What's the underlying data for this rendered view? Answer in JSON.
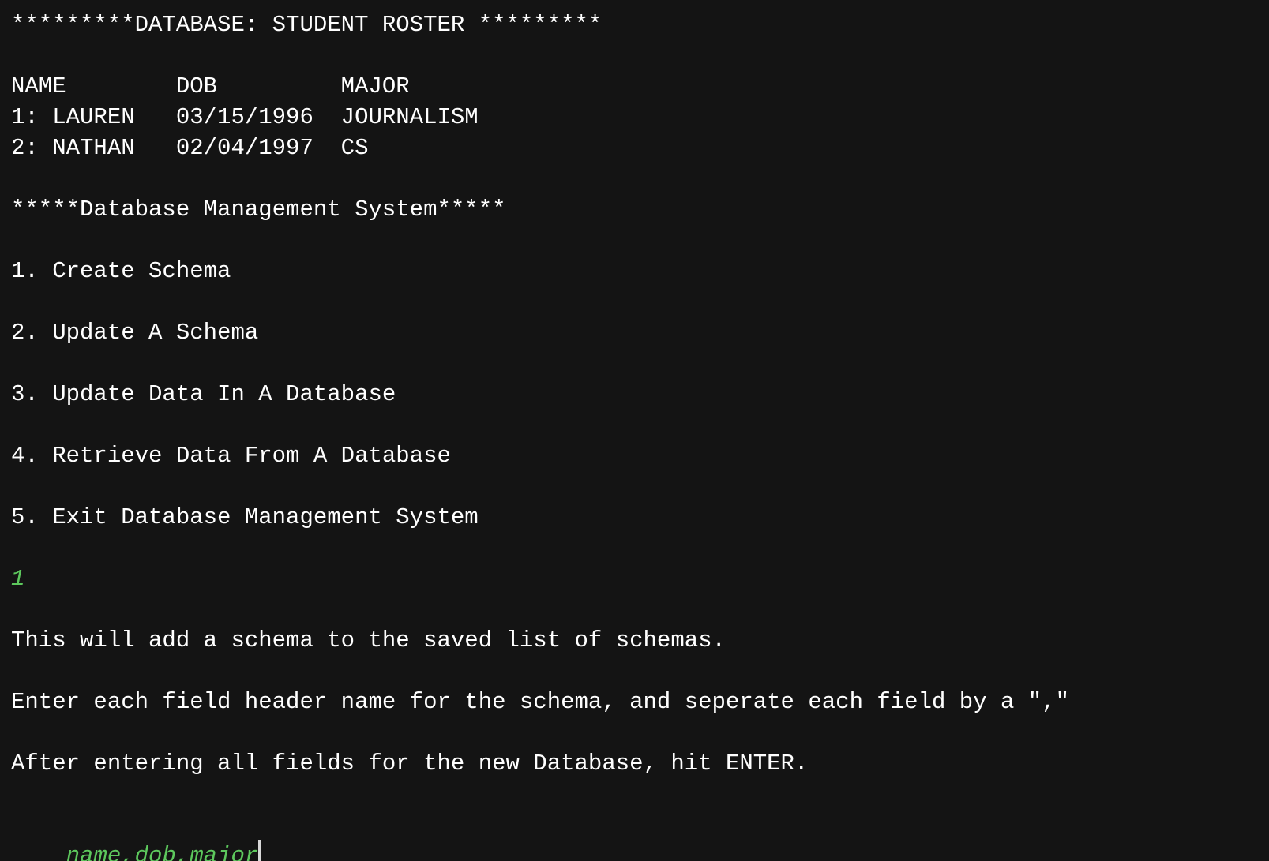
{
  "terminal": {
    "banner": "*********DATABASE: STUDENT ROSTER *********",
    "roster": {
      "header": "NAME        DOB         MAJOR",
      "rows": [
        "1: LAUREN   03/15/1996  JOURNALISM",
        "2: NATHAN   02/04/1997  CS"
      ]
    },
    "menu_title": "*****Database Management System*****",
    "menu": [
      "1. Create Schema",
      "2. Update A Schema",
      "3. Update Data In A Database",
      "4. Retrieve Data From A Database",
      "5. Exit Database Management System"
    ],
    "user_choice": "1",
    "messages": [
      "This will add a schema to the saved list of schemas.",
      "Enter each field header name for the schema, and seperate each field by a \",\"",
      "After entering all fields for the new Database, hit ENTER."
    ],
    "user_input": "name,dob,major",
    "colors": {
      "background": "#141414",
      "text": "#ffffff",
      "input": "#5dc85d"
    }
  }
}
